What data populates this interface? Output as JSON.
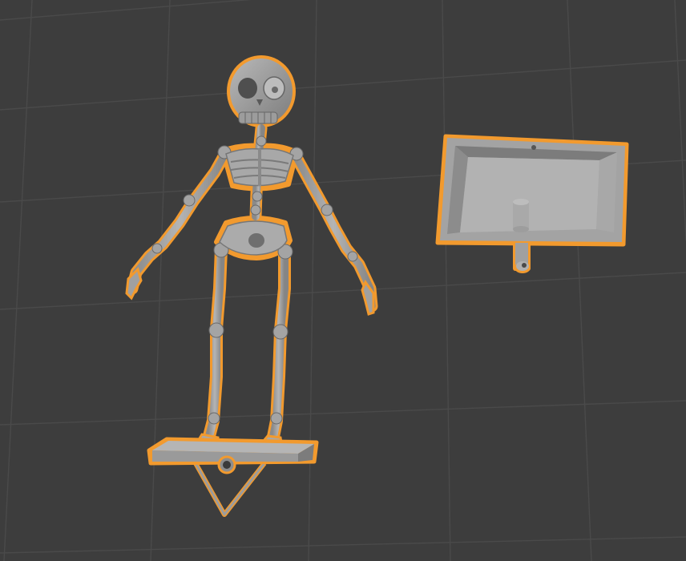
{
  "viewport": {
    "name": "3d-viewport",
    "background": "#3d3d3d",
    "grid_color": "#484848",
    "selection_outline_color": "#f29a2e",
    "mesh_color": "#9e9e9e",
    "mesh_shadow_color": "#6f6f6f"
  },
  "objects": [
    {
      "name": "skeleton",
      "selected": true
    },
    {
      "name": "stand-base",
      "selected": true
    },
    {
      "name": "box-enclosure",
      "selected": true
    }
  ]
}
